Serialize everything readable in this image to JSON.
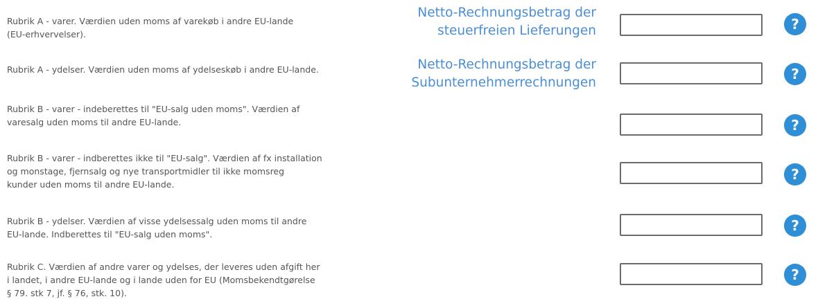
{
  "rows": [
    {
      "label": "Rubrik A - varer. Værdien uden moms af varekøb i andre EU-lande\n(EU-erhvervelser).",
      "value": "",
      "help": "?"
    },
    {
      "label": "Rubrik A - ydelser. Værdien uden moms af ydelseskøb i andre EU-lande.",
      "value": "",
      "help": "?"
    },
    {
      "label": "Rubrik B - varer - indeberettes til \"EU-salg uden moms\". Værdien af\nvaresalg uden moms til andre EU-lande.",
      "value": "",
      "help": "?"
    },
    {
      "label": "Rubrik B - varer - indberettes ikke til \"EU-salg\". Værdien af fx installation\nog monstage, fjernsalg og nye transportmidler til ikke momsreg\nkunder uden moms til andre EU-lande.",
      "value": "",
      "help": "?"
    },
    {
      "label": "Rubrik B - ydelser. Værdien af visse ydelsessalg uden moms til andre\nEU-lande. Indberettes til \"EU-salg uden moms\".",
      "value": "",
      "help": "?"
    },
    {
      "label": "Rubrik C. Værdien af andre varer og ydelses, der leveres uden afgift her\ni landet, i andre EU-lande og i lande uden for EU (Momsbekendtgørelse\n§ 79. stk 7, jf. § 76, stk. 10).",
      "value": "",
      "help": "?"
    }
  ],
  "overlays": [
    "Netto-Rechnungsbetrag der\nsteuerfreien Lieferungen",
    "Netto-Rechnungsbetrag der\nSubunternehmerrechnungen"
  ],
  "colors": {
    "label_text": "#555555",
    "overlay_text": "#4a8ed6",
    "help_button": "#2e8fd6",
    "input_border": "#6b6b6b"
  },
  "icons": {
    "help": "question-mark-circle-icon"
  }
}
